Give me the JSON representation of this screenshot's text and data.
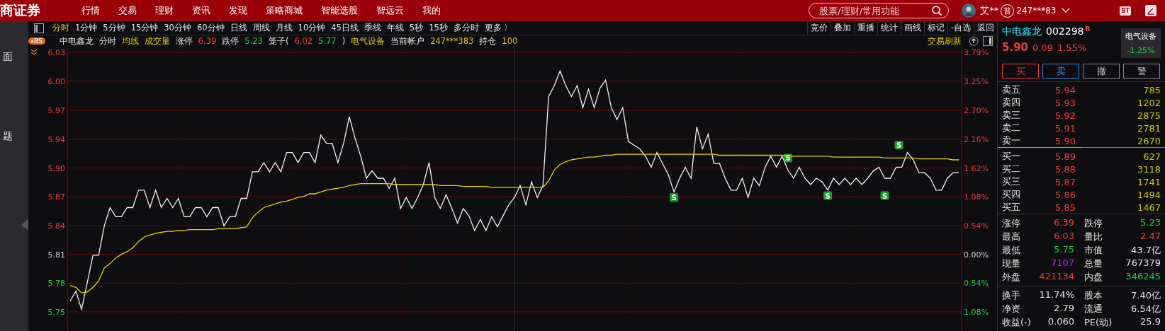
{
  "top_bar": {
    "logo": "商证券",
    "nav": [
      "行情",
      "交易",
      "理财",
      "资讯",
      "发现",
      "策略商城",
      "智能选股",
      "智远云",
      "我的"
    ]
  },
  "search": {
    "placeholder": "股票/理财/常用功能"
  },
  "user": {
    "name": "艾**",
    "badge": "普",
    "account": "247***83",
    "app_badge": "BT"
  },
  "sidebar": {
    "items": [
      "面",
      "题"
    ]
  },
  "period_tabs": [
    {
      "label": "分时",
      "selected": true
    },
    {
      "label": "1分钟",
      "selected": false
    },
    {
      "label": "5分钟",
      "selected": false
    },
    {
      "label": "15分钟",
      "selected": false
    },
    {
      "label": "30分钟",
      "selected": false
    },
    {
      "label": "60分钟",
      "selected": false
    },
    {
      "label": "日线",
      "selected": false
    },
    {
      "label": "周线",
      "selected": false
    },
    {
      "label": "月线",
      "selected": false
    },
    {
      "label": "10分钟",
      "selected": false
    },
    {
      "label": "45日线",
      "selected": false
    },
    {
      "label": "季线",
      "selected": false
    },
    {
      "label": "年线",
      "selected": false
    },
    {
      "label": "5秒",
      "selected": false
    },
    {
      "label": "15秒",
      "selected": false
    },
    {
      "label": "多分时",
      "selected": false
    },
    {
      "label": "更多 〉",
      "selected": false
    }
  ],
  "tools": [
    "竞价",
    "叠加",
    "重播",
    "统计",
    "画线",
    "标记",
    "-自选",
    "返回"
  ],
  "info_bar": {
    "badge": "BS",
    "refresh": "交易刷新",
    "items": [
      {
        "text": "中电鑫龙",
        "kind": "label"
      },
      {
        "text": "分时",
        "kind": "label"
      },
      {
        "text": "均线",
        "kind": "accent"
      },
      {
        "text": "成交量",
        "kind": "accent"
      },
      {
        "text": "涨停",
        "kind": "label"
      },
      {
        "text": "6.39",
        "kind": "up"
      },
      {
        "text": "跌停",
        "kind": "label"
      },
      {
        "text": "5.23",
        "kind": "down"
      },
      {
        "text": "笼子(",
        "kind": "label"
      },
      {
        "text": "6.02",
        "kind": "up"
      },
      {
        "text": "5.77",
        "kind": "down"
      },
      {
        "text": ")",
        "kind": "label"
      },
      {
        "text": "电气设备",
        "kind": "accent"
      },
      {
        "text": "当前帐户",
        "kind": "label"
      },
      {
        "text": "247***383",
        "kind": "accent"
      },
      {
        "text": "持仓",
        "kind": "label"
      },
      {
        "text": "100",
        "kind": "accent"
      }
    ]
  },
  "chart": {
    "percent_labels": [
      {
        "label": "3.79%",
        "color": "#f0393f"
      },
      {
        "label": "3.25%",
        "color": "#f0393f"
      },
      {
        "label": "2.70%",
        "color": "#f0393f"
      },
      {
        "label": "2.16%",
        "color": "#f0393f"
      },
      {
        "label": "1.62%",
        "color": "#f0393f"
      },
      {
        "label": "1.08%",
        "color": "#f0393f"
      },
      {
        "label": "0.54%",
        "color": "#f0393f"
      },
      {
        "label": "0.00%",
        "color": "#d0d0d0"
      },
      {
        "label": "0.54%",
        "color": "#22c84a"
      },
      {
        "label": "1.08%",
        "color": "#22c84a"
      }
    ],
    "sell_marks": [
      "S",
      "S",
      "S",
      "S",
      "S"
    ],
    "chart_data": {
      "type": "line",
      "grid": true,
      "ylim": [
        5.7264,
        6.0364
      ],
      "yticks": [
        {
          "value": 5.7473,
          "label": "5.75"
        },
        {
          "value": 5.7786,
          "label": "5.78"
        },
        {
          "value": 5.81,
          "label": "5.81"
        },
        {
          "value": 5.8414,
          "label": "5.84"
        },
        {
          "value": 5.8727,
          "label": "5.87"
        },
        {
          "value": 5.9041,
          "label": "5.90"
        },
        {
          "value": 5.9355,
          "label": "5.94"
        },
        {
          "value": 5.9669,
          "label": "5.97"
        },
        {
          "value": 5.9988,
          "label": "6.00"
        },
        {
          "value": 6.0302,
          "label": "6.03"
        }
      ],
      "categories": [
        null,
        null,
        null,
        null,
        null,
        null,
        null,
        null,
        null,
        null,
        null,
        null,
        null,
        null,
        null,
        null,
        null,
        null,
        null,
        null,
        null,
        null,
        null,
        null,
        null,
        null,
        null,
        null,
        null,
        null,
        null,
        null,
        null,
        null,
        null,
        null,
        null,
        null,
        null,
        null,
        null,
        null,
        null,
        null,
        null,
        null,
        null,
        null,
        null,
        null,
        null,
        null,
        null,
        null,
        null,
        null,
        null,
        null,
        null,
        null,
        null,
        null,
        null,
        null,
        null,
        null,
        null,
        null,
        null,
        null,
        null,
        null,
        null,
        null,
        null,
        null,
        null,
        null,
        null,
        null,
        null,
        null,
        null,
        null,
        null,
        null,
        null,
        null,
        null,
        null,
        null,
        null,
        null,
        null,
        null,
        null,
        null,
        null,
        null,
        null,
        null,
        null,
        null,
        null,
        null,
        null,
        null,
        null,
        null,
        null,
        null,
        null,
        null,
        null,
        null,
        null,
        null,
        null,
        null,
        null,
        null,
        null,
        null,
        null,
        null,
        null,
        null,
        null,
        null,
        null,
        null,
        null,
        null,
        null,
        null,
        null,
        null,
        null,
        null,
        null,
        null,
        null,
        null,
        null,
        null,
        null,
        null,
        null,
        null,
        null,
        null,
        null,
        null,
        null,
        null,
        null,
        null
      ],
      "series": [
        {
          "color": "#f2f2f2",
          "values": [
            5.759,
            5.77,
            5.75,
            5.779,
            5.809,
            5.809,
            5.841,
            5.861,
            5.851,
            5.851,
            5.861,
            5.861,
            5.88,
            5.88,
            5.861,
            5.88,
            5.861,
            5.871,
            5.861,
            5.871,
            5.851,
            5.851,
            5.861,
            5.861,
            5.851,
            5.861,
            5.861,
            5.841,
            5.851,
            5.851,
            5.871,
            5.871,
            5.9,
            5.9,
            5.91,
            5.9,
            5.91,
            5.9,
            5.921,
            5.921,
            5.91,
            5.921,
            5.921,
            5.91,
            5.94,
            5.931,
            5.931,
            5.91,
            5.931,
            5.96,
            5.937,
            5.917,
            5.893,
            5.901,
            5.893,
            5.893,
            5.882,
            5.893,
            5.86,
            5.872,
            5.86,
            5.872,
            5.886,
            5.91,
            5.872,
            5.86,
            5.875,
            5.86,
            5.844,
            5.86,
            5.852,
            5.836,
            5.848,
            5.836,
            5.851,
            5.84,
            5.852,
            5.864,
            5.872,
            5.885,
            5.864,
            5.889,
            5.872,
            5.885,
            5.982,
            5.994,
            6.01,
            5.994,
            5.982,
            5.994,
            5.97,
            5.99,
            5.97,
            5.991,
            6.0,
            5.97,
            5.957,
            5.97,
            5.933,
            5.929,
            5.925,
            5.917,
            5.905,
            5.921,
            5.909,
            5.897,
            5.878,
            5.893,
            5.905,
            5.893,
            5.949,
            5.925,
            5.941,
            5.909,
            5.909,
            5.893,
            5.88,
            5.88,
            5.893,
            5.872,
            5.893,
            5.885,
            5.905,
            5.917,
            5.905,
            5.917,
            5.902,
            5.893,
            5.905,
            5.893,
            5.886,
            5.893,
            5.889,
            5.88,
            5.893,
            5.886,
            5.893,
            5.886,
            5.893,
            5.886,
            5.893,
            5.901,
            5.905,
            5.893,
            5.893,
            5.905,
            5.905,
            5.921,
            5.913,
            5.899,
            5.899,
            5.893,
            5.88,
            5.88,
            5.893,
            5.899,
            5.899
          ]
        },
        {
          "color": "#e6d000",
          "values": [
            5.776,
            5.774,
            5.768,
            5.769,
            5.774,
            5.781,
            5.795,
            5.8,
            5.806,
            5.81,
            5.813,
            5.817,
            5.824,
            5.829,
            5.831,
            5.833,
            5.834,
            5.835,
            5.835,
            5.836,
            5.836,
            5.837,
            5.837,
            5.837,
            5.837,
            5.837,
            5.838,
            5.838,
            5.838,
            5.838,
            5.839,
            5.84,
            5.85,
            5.856,
            5.861,
            5.863,
            5.865,
            5.867,
            5.868,
            5.87,
            5.872,
            5.873,
            5.876,
            5.876,
            5.878,
            5.88,
            5.881,
            5.882,
            5.883,
            5.885,
            5.886,
            5.887,
            5.887,
            5.887,
            5.887,
            5.887,
            5.887,
            5.886,
            5.886,
            5.886,
            5.886,
            5.886,
            5.886,
            5.886,
            5.886,
            5.885,
            5.885,
            5.885,
            5.885,
            5.884,
            5.884,
            5.884,
            5.884,
            5.884,
            5.883,
            5.883,
            5.883,
            5.883,
            5.883,
            5.883,
            5.883,
            5.883,
            5.883,
            5.883,
            5.89,
            5.902,
            5.908,
            5.911,
            5.913,
            5.914,
            5.915,
            5.916,
            5.916,
            5.917,
            5.918,
            5.918,
            5.919,
            5.919,
            5.919,
            5.919,
            5.919,
            5.919,
            5.919,
            5.919,
            5.919,
            5.919,
            5.919,
            5.919,
            5.919,
            5.919,
            5.919,
            5.919,
            5.919,
            5.919,
            5.918,
            5.918,
            5.918,
            5.918,
            5.918,
            5.918,
            5.918,
            5.918,
            5.918,
            5.918,
            5.918,
            5.918,
            5.917,
            5.917,
            5.917,
            5.917,
            5.917,
            5.917,
            5.917,
            5.917,
            5.916,
            5.916,
            5.916,
            5.916,
            5.916,
            5.916,
            5.916,
            5.916,
            5.916,
            5.915,
            5.915,
            5.915,
            5.915,
            5.915,
            5.915,
            5.914,
            5.914,
            5.914,
            5.914,
            5.914,
            5.914,
            5.913,
            5.913
          ]
        }
      ]
    }
  },
  "quote": {
    "name": "中电鑫龙",
    "code": "002298",
    "flag": "R",
    "sector": "电气设备",
    "sector_change": "-1.25%",
    "price": "5.90",
    "change": "0.09",
    "pct": "1.55%"
  },
  "trade_buttons": [
    {
      "label": "买",
      "color": "#e0343a"
    },
    {
      "label": "卖",
      "color": "#2f86d6"
    },
    {
      "label": "撤",
      "color": "#8a8a8a"
    },
    {
      "label": "警",
      "color": "#8a8a8a"
    }
  ],
  "asks": [
    {
      "label": "卖五",
      "price": "5.94",
      "volume": "785"
    },
    {
      "label": "卖四",
      "price": "5.93",
      "volume": "1202"
    },
    {
      "label": "卖三",
      "price": "5.92",
      "volume": "2875"
    },
    {
      "label": "卖二",
      "price": "5.91",
      "volume": "2781"
    },
    {
      "label": "卖一",
      "price": "5.90",
      "volume": "2670"
    }
  ],
  "bids": [
    {
      "label": "买一",
      "price": "5.89",
      "volume": "627"
    },
    {
      "label": "买二",
      "price": "5.88",
      "volume": "3118"
    },
    {
      "label": "买三",
      "price": "5.87",
      "volume": "1741"
    },
    {
      "label": "买四",
      "price": "5.86",
      "volume": "1494"
    },
    {
      "label": "买五",
      "price": "5.85",
      "volume": "1467"
    }
  ],
  "stats": [
    {
      "label": "涨停",
      "value": "6.39",
      "color": "#f0393f"
    },
    {
      "label": "跌停",
      "value": "5.23",
      "color": "#22c84a"
    },
    {
      "label": "最高",
      "value": "6.03",
      "color": "#f0393f"
    },
    {
      "label": "量比",
      "value": "2.47",
      "color": "#f0393f"
    },
    {
      "label": "最低",
      "value": "5.75",
      "color": "#22c84a"
    },
    {
      "label": "市值",
      "value": "43.7亿",
      "color": "#e6e6e6"
    },
    {
      "label": "现量",
      "value": "7107",
      "color": "#b030d8"
    },
    {
      "label": "总量",
      "value": "767379",
      "color": "#e6e6e6"
    },
    {
      "label": "外盘",
      "value": "421134",
      "color": "#f0393f"
    },
    {
      "label": "内盘",
      "value": "346245",
      "color": "#22c84a"
    }
  ],
  "fundamentals": [
    {
      "label": "换手",
      "value": "11.74%"
    },
    {
      "label": "股本",
      "value": "7.40亿"
    },
    {
      "label": "净资",
      "value": "2.79"
    },
    {
      "label": "流通",
      "value": "6.54亿"
    },
    {
      "label": "收益(-)",
      "value": "0.060"
    },
    {
      "label": "PE(动)",
      "value": "25.9"
    }
  ]
}
